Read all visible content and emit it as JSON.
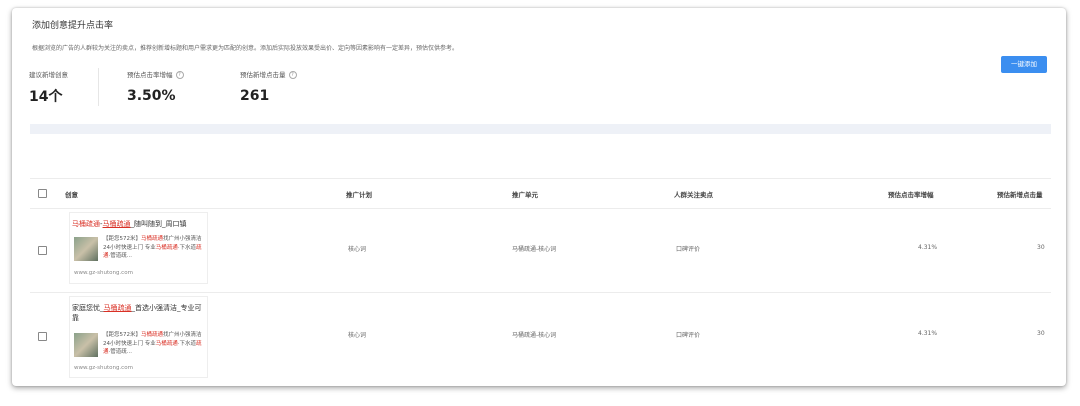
{
  "header": {
    "title": "添加创意提升点击率",
    "description": "根据浏览的广告的人群较为关注的卖点，推荐创新增标题和用户需求更为匹配的创意。添加后实际投放效果受出价、定向等因素影响有一定差异，预估仅供参考。",
    "add_all_button": "一键添加"
  },
  "metrics": [
    {
      "label": "建议新增创意",
      "value": "14个"
    },
    {
      "label": "预估点击率增幅",
      "value": "3.50%"
    },
    {
      "label": "预估新增点击量",
      "value": "261"
    }
  ],
  "table": {
    "headers": [
      "创意",
      "推广计划",
      "推广单元",
      "人群关注卖点",
      "预估点击率增幅",
      "预估新增点击量"
    ],
    "rows": [
      {
        "title": {
          "kw1": "马桶疏通",
          "sep1": "-",
          "kw2": "马桶疏通",
          "rest": "_随叫随到_周口镇"
        },
        "body": {
          "p1": "【距您572米】",
          "kw1": "马桶疏通",
          "p2": "找广州小强清洁24小时快速上门 专业",
          "kw2": "马桶疏通",
          "p3": "·下水道",
          "kw3": "疏通",
          "p4": "·管道疏..."
        },
        "url": "www.gz-shutong.com",
        "plan": "核心词",
        "unit": "马桶疏通-核心词",
        "selling_point": "口碑评价",
        "ctr_increase": "4.31%",
        "clicks": "30"
      },
      {
        "title": {
          "p1": "家庭您忧_",
          "kw1": "马桶疏通",
          "rest": "_首选小强清洁_专业可靠"
        },
        "body": {
          "p1": "【距您572米】",
          "kw1": "马桶疏通",
          "p2": "找广州小强清洁24小时快速上门 专业",
          "kw2": "马桶疏通",
          "p3": "·下水道",
          "kw3": "疏通",
          "p4": "·管道疏..."
        },
        "url": "www.gz-shutong.com",
        "plan": "核心词",
        "unit": "马桶疏通-核心词",
        "selling_point": "口碑评价",
        "ctr_increase": "4.31%",
        "clicks": "30"
      }
    ]
  }
}
